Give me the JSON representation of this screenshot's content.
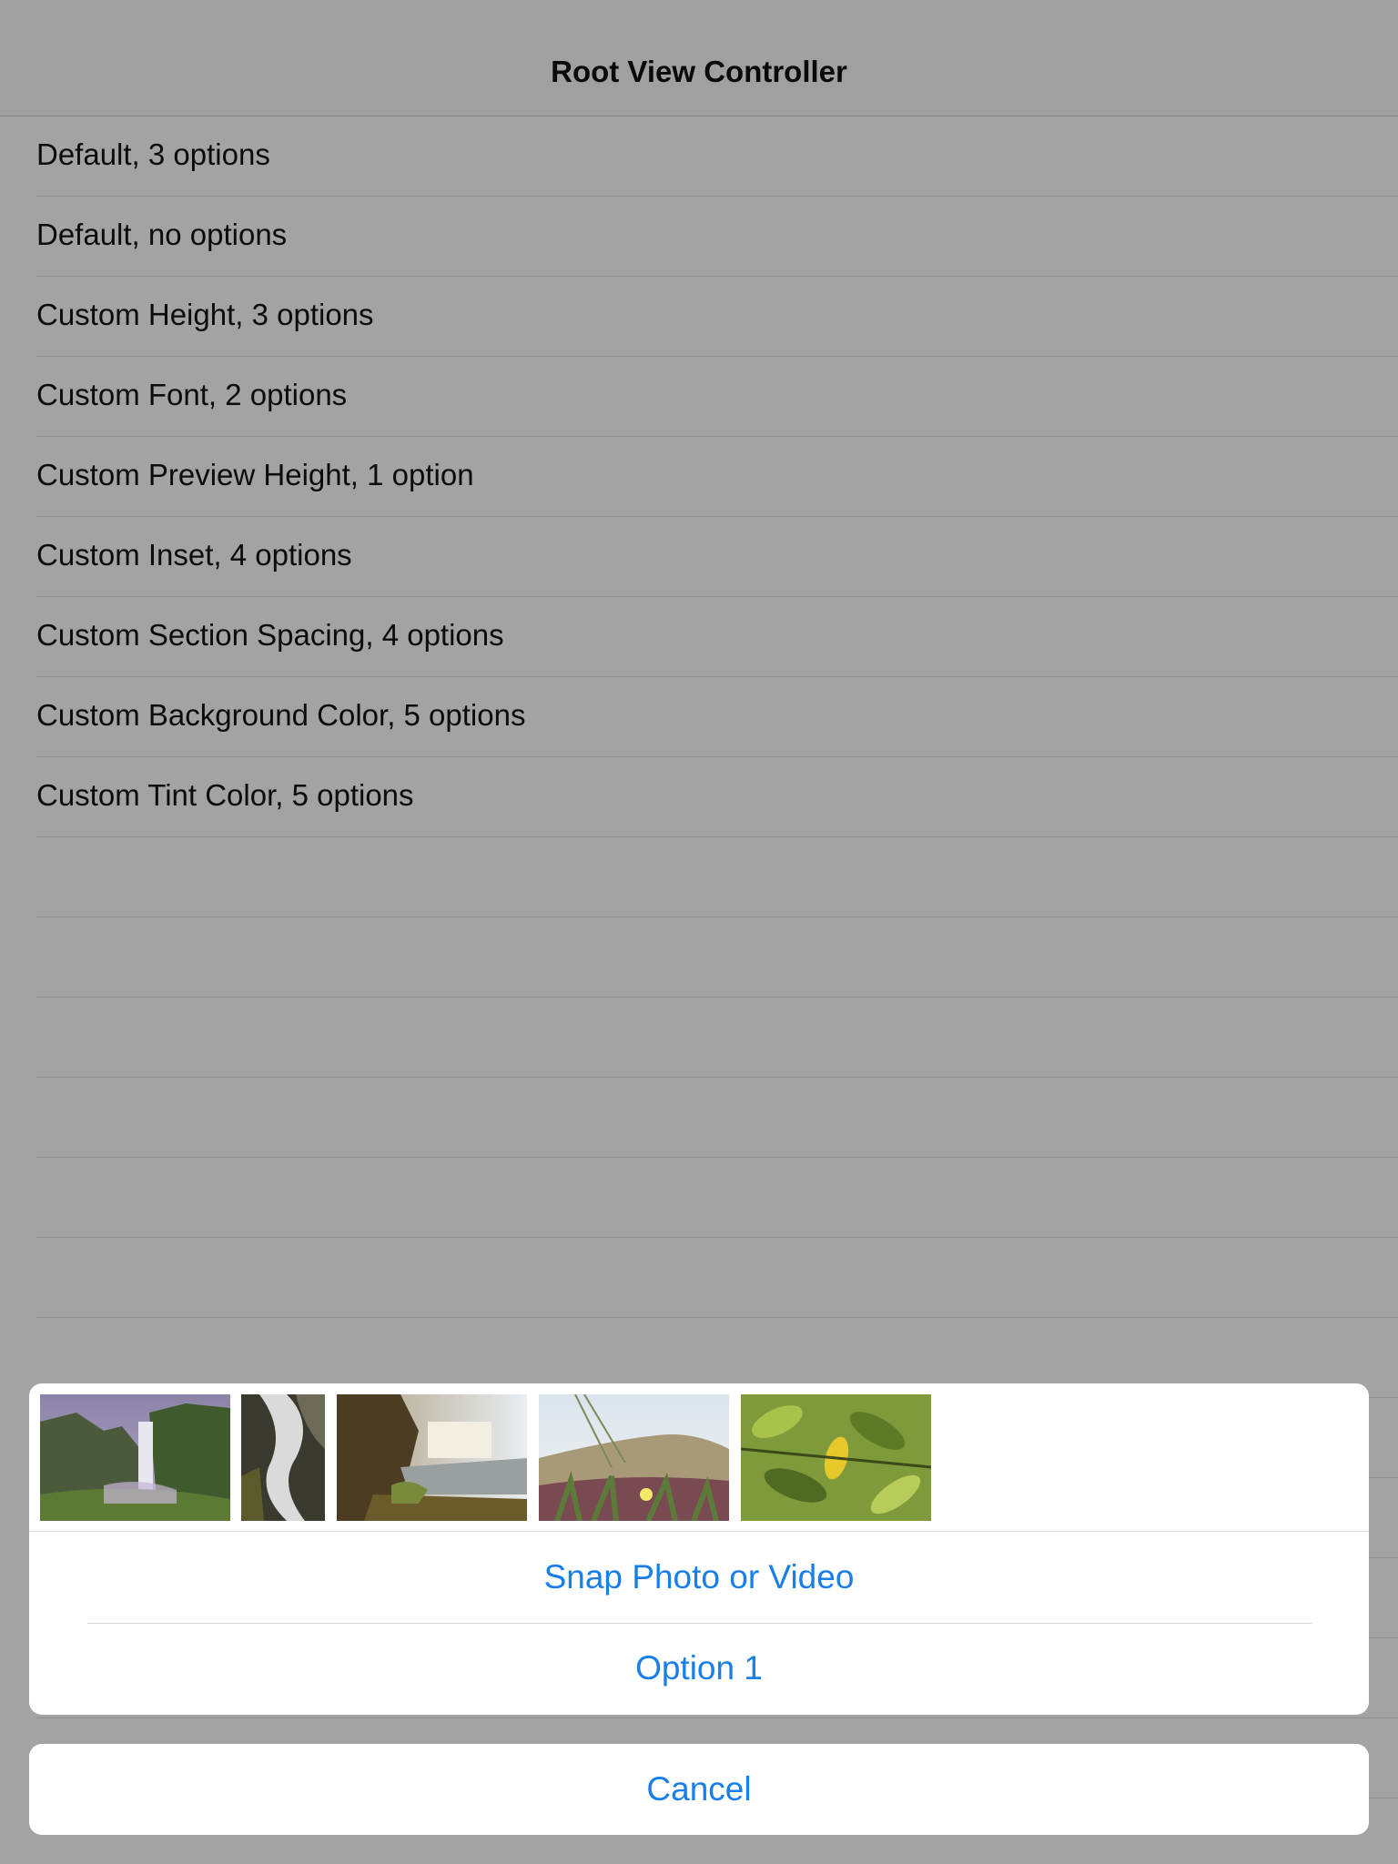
{
  "navbar": {
    "title": "Root View Controller"
  },
  "table": {
    "rows": [
      {
        "label": "Default, 3 options"
      },
      {
        "label": "Default, no options"
      },
      {
        "label": "Custom Height, 3 options"
      },
      {
        "label": "Custom Font, 2 options"
      },
      {
        "label": "Custom Preview Height, 1 option"
      },
      {
        "label": "Custom Inset, 4 options"
      },
      {
        "label": "Custom Section Spacing, 4 options"
      },
      {
        "label": "Custom Background Color, 5 options"
      },
      {
        "label": "Custom Tint Color, 5 options"
      }
    ]
  },
  "action_sheet": {
    "photos": [
      {
        "subject": "waterfall-cliff"
      },
      {
        "subject": "waterfall-closeup"
      },
      {
        "subject": "waterfall-rocks"
      },
      {
        "subject": "dune-grass-flowers"
      },
      {
        "subject": "leaves-yellow"
      }
    ],
    "options": [
      {
        "label": "Snap Photo or Video"
      },
      {
        "label": "Option 1"
      }
    ],
    "cancel_label": "Cancel"
  },
  "colors": {
    "dimmed_background": "#a3a3a3",
    "tint": "#1a7ee8",
    "sheet_background": "#ffffff"
  }
}
